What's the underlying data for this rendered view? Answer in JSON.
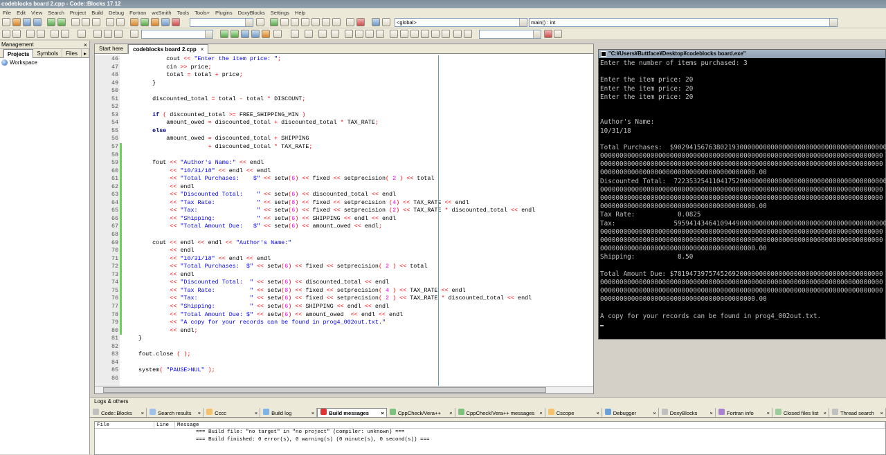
{
  "window": {
    "title": "codeblocks board 2.cpp - Code::Blocks 17.12"
  },
  "menu": [
    "File",
    "Edit",
    "View",
    "Search",
    "Project",
    "Build",
    "Debug",
    "Fortran",
    "wxSmith",
    "Tools",
    "Tools+",
    "Plugins",
    "DoxyBlocks",
    "Settings",
    "Help"
  ],
  "toolbar": {
    "scope_combo": "<global>",
    "function_combo": "main() : int"
  },
  "management": {
    "title": "Management",
    "tabs": [
      "Projects",
      "Symbols",
      "Files"
    ],
    "workspace": "Workspace"
  },
  "editor": {
    "tabs": [
      {
        "label": "Start here"
      },
      {
        "label": "codeblocks board 2.cpp"
      }
    ],
    "lines": [
      {
        "n": "46",
        "c": "          cout << \"Enter the item price: \";"
      },
      {
        "n": "47",
        "c": "          cin >> price;"
      },
      {
        "n": "48",
        "c": "          total = total + price;"
      },
      {
        "n": "49",
        "c": "      }"
      },
      {
        "n": "50",
        "c": ""
      },
      {
        "n": "51",
        "c": "      discounted_total = total - total * DISCOUNT;"
      },
      {
        "n": "52",
        "c": ""
      },
      {
        "n": "53",
        "c": "      if ( discounted_total >= FREE_SHIPPING_MIN )"
      },
      {
        "n": "54",
        "c": "          amount_owed = discounted_total + discounted_total * TAX_RATE;"
      },
      {
        "n": "55",
        "c": "      else"
      },
      {
        "n": "56",
        "c": "          amount_owed = discounted_total + SHIPPING"
      },
      {
        "n": "57",
        "c": "                      + discounted_total * TAX_RATE;"
      },
      {
        "n": "58",
        "c": ""
      },
      {
        "n": "59",
        "c": "      fout << \"Author's Name:\" << endl"
      },
      {
        "n": "60",
        "c": "           << \"10/31/18\" << endl << endl"
      },
      {
        "n": "61",
        "c": "           << \"Total Purchases:    $\" << setw(6) << fixed << setprecision( 2 ) << total"
      },
      {
        "n": "62",
        "c": "           << endl"
      },
      {
        "n": "63",
        "c": "           << \"Discounted Total:    \" << setw(6) << discounted_total << endl"
      },
      {
        "n": "64",
        "c": "           << \"Tax Rate:            \" << setw(8) << fixed << setprecision (4) << TAX_RATE << endl"
      },
      {
        "n": "65",
        "c": "           << \"Tax:                 \" << setw(6) << fixed << setprecision (2) << TAX_RATE * discounted_total << endl"
      },
      {
        "n": "66",
        "c": "           << \"Shipping:            \" << setw(6) << SHIPPING << endl << endl"
      },
      {
        "n": "67",
        "c": "           << \"Total Amount Due:   $\" << setw(6) << amount_owed << endl;"
      },
      {
        "n": "68",
        "c": ""
      },
      {
        "n": "69",
        "c": "      cout << endl << endl << \"Author's Name:\""
      },
      {
        "n": "70",
        "c": "           << endl"
      },
      {
        "n": "71",
        "c": "           << \"10/31/18\" << endl << endl"
      },
      {
        "n": "72",
        "c": "           << \"Total Purchases:  $\" << setw(6) << fixed << setprecision( 2 ) << total"
      },
      {
        "n": "73",
        "c": "           << endl"
      },
      {
        "n": "74",
        "c": "           << \"Discounted Total:  \" << setw(6) << discounted_total << endl"
      },
      {
        "n": "75",
        "c": "           << \"Tax Rate:          \" << setw(8) << fixed << setprecision( 4 ) << TAX_RATE << endl"
      },
      {
        "n": "76",
        "c": "           << \"Tax:               \" << setw(6) << fixed << setprecision( 2 ) << TAX_RATE * discounted_total << endl"
      },
      {
        "n": "77",
        "c": "           << \"Shipping:          \" << setw(6) << SHIPPING << endl << endl"
      },
      {
        "n": "78",
        "c": "           << \"Total Amount Due: $\" << setw(6) << amount_owed  << endl << endl"
      },
      {
        "n": "79",
        "c": "           << \"A copy for your records can be found in prog4_002out.txt.\""
      },
      {
        "n": "80",
        "c": "           << endl;"
      },
      {
        "n": "81",
        "c": "  }"
      },
      {
        "n": "82",
        "c": ""
      },
      {
        "n": "83",
        "c": "  fout.close ( );"
      },
      {
        "n": "84",
        "c": ""
      },
      {
        "n": "85",
        "c": "  system( \"PAUSE>NUL\" );"
      },
      {
        "n": "86",
        "c": ""
      }
    ]
  },
  "console": {
    "title": "\"C:¥Users¥Buttface¥Desktop¥codeblocks board.exe\"",
    "lines": [
      "Enter the number of items purchased: 3",
      "",
      "Enter the item price: 20",
      "Enter the item price: 20",
      "Enter the item price: 20",
      "",
      "",
      "Author's Name:",
      "10/31/18",
      "",
      "Total Purchases:  $902941567638021930000000000000000000000000000000000000000",
      "0000000000000000000000000000000000000000000000000000000000000000000000000",
      "0000000000000000000000000000000000000000000000000000000000000000000000000",
      "0000000000000000000000000000000000000000.00",
      "Discounted Total:  72235325411041752000000000000000000000000000000000000000",
      "0000000000000000000000000000000000000000000000000000000000000000000000000",
      "0000000000000000000000000000000000000000000000000000000000000000000000000",
      "0000000000000000000000000000000000000000.00",
      "Tax Rate:           0.0825",
      "Tax:               5959414346410944900000000000000000000000000000000000000",
      "0000000000000000000000000000000000000000000000000000000000000000000000000",
      "0000000000000000000000000000000000000000000000000000000000000000000000000",
      "0000000000000000000000000000000000000000.00",
      "Shipping:           8.50",
      "",
      "Total Amount Due: $781947397574526920000000000000000000000000000000000000",
      "0000000000000000000000000000000000000000000000000000000000000000000000000",
      "0000000000000000000000000000000000000000000000000000000000000000000000000",
      "0000000000000000000000000000000000000000.00",
      "",
      "A copy for your records can be found in prog4_002out.txt."
    ]
  },
  "logs": {
    "title": "Logs & others",
    "tabs": [
      "Code::Blocks",
      "Search results",
      "Cccc",
      "Build log",
      "Build messages",
      "CppCheck/Vera++",
      "CppCheck/Vera++ messages",
      "Cscope",
      "Debugger",
      "DoxyBlocks",
      "Fortran info",
      "Closed files list",
      "Thread search"
    ],
    "columns": [
      "File",
      "Line",
      "Message"
    ],
    "messages": [
      "=== Build file: \"no target\" in \"no project\" (compiler: unknown) ===",
      "=== Build finished: 0 error(s), 0 warning(s) (0 minute(s), 0 second(s)) ==="
    ]
  },
  "colors": {
    "changed_bar": "#6ccf5e",
    "edge_line": "#5a9bd5",
    "console_bg": "#000000"
  }
}
